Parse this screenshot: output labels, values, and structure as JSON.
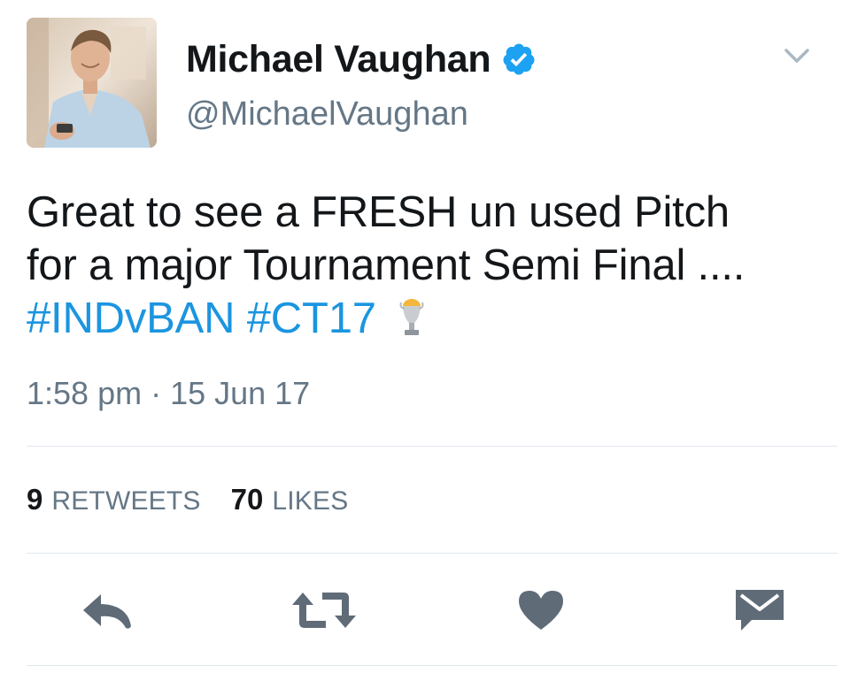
{
  "tweet": {
    "author": {
      "display_name": "Michael Vaughan",
      "handle": "@MichaelVaughan",
      "verified": true
    },
    "text_line_1": "Great to see a FRESH un used Pitch",
    "text_line_2": "for a major Tournament Semi Final ....",
    "hashtags": [
      "#INDvBAN",
      "#CT17"
    ],
    "timestamp": "1:58 pm · 15 Jun 17",
    "stats": {
      "retweets_count": "9",
      "retweets_label": "RETWEETS",
      "likes_count": "70",
      "likes_label": "LIKES"
    }
  },
  "actions": {
    "reply_icon": "reply-icon",
    "retweet_icon": "retweet-icon",
    "like_icon": "heart-icon",
    "dm_icon": "envelope-icon"
  },
  "colors": {
    "text": "#14171a",
    "secondary": "#657786",
    "link": "#1b95e0",
    "verified": "#1da1f2",
    "divider": "#e1e8ed",
    "action_icon": "#5f6b77"
  }
}
